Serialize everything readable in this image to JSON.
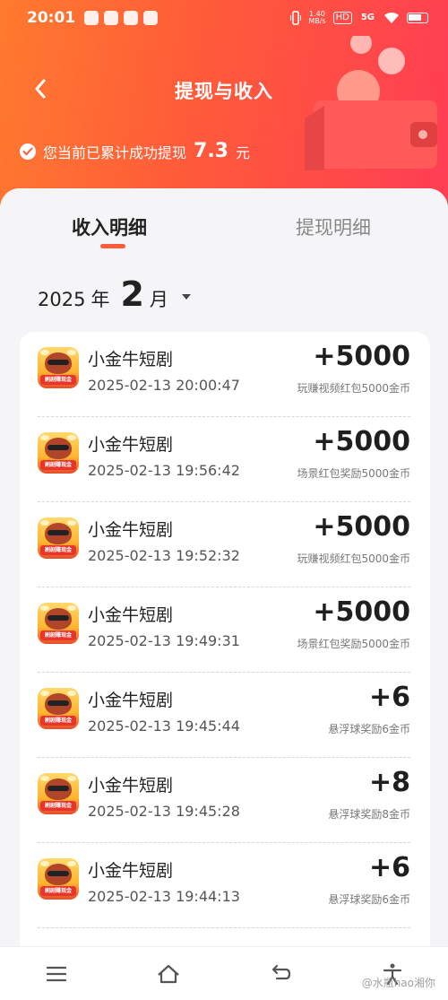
{
  "status_bar": {
    "time": "20:01",
    "net_speed_value": "1.40",
    "net_speed_unit": "MB/s",
    "hd_label": "HD",
    "network": "5G"
  },
  "header": {
    "title": "提现与收入",
    "total_prefix": "您当前已累计成功提现",
    "total_amount": "7.3",
    "total_unit": "元"
  },
  "tabs": {
    "income": "收入明细",
    "withdraw": "提现明细",
    "active": "income"
  },
  "month": {
    "year": "2025",
    "year_unit": "年",
    "month": "2",
    "month_unit": "月"
  },
  "records": [
    {
      "name": "小金牛短剧",
      "time": "2025-02-13 20:00:47",
      "amount": "+5000",
      "desc": "玩赚视频红包5000金币"
    },
    {
      "name": "小金牛短剧",
      "time": "2025-02-13 19:56:42",
      "amount": "+5000",
      "desc": "场景红包奖励5000金币"
    },
    {
      "name": "小金牛短剧",
      "time": "2025-02-13 19:52:32",
      "amount": "+5000",
      "desc": "玩赚视频红包5000金币"
    },
    {
      "name": "小金牛短剧",
      "time": "2025-02-13 19:49:31",
      "amount": "+5000",
      "desc": "场景红包奖励5000金币"
    },
    {
      "name": "小金牛短剧",
      "time": "2025-02-13 19:45:44",
      "amount": "+6",
      "desc": "悬浮球奖励6金币"
    },
    {
      "name": "小金牛短剧",
      "time": "2025-02-13 19:45:28",
      "amount": "+8",
      "desc": "悬浮球奖励8金币"
    },
    {
      "name": "小金牛短剧",
      "time": "2025-02-13 19:44:13",
      "amount": "+6",
      "desc": "悬浮球奖励6金币"
    }
  ],
  "app_icon_banner": "刷剧赚现金",
  "bottom_nav": [
    "menu-icon",
    "home-icon",
    "back-icon",
    "accessibility-icon"
  ],
  "watermark": "@水瓶hao湘你",
  "colors": {
    "header_start": "#ff7a2e",
    "header_end": "#ff3d55",
    "accent": "#ff5a3a"
  }
}
